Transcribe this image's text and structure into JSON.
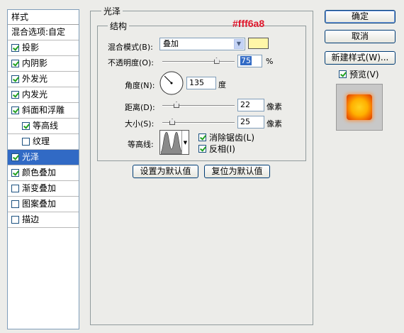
{
  "sidebar": {
    "header": "样式",
    "items": [
      {
        "label": "混合选项:自定",
        "checkbox": false,
        "checked": false,
        "sub": false,
        "selected": false
      },
      {
        "label": "投影",
        "checkbox": true,
        "checked": true,
        "sub": false,
        "selected": false
      },
      {
        "label": "内阴影",
        "checkbox": true,
        "checked": true,
        "sub": false,
        "selected": false
      },
      {
        "label": "外发光",
        "checkbox": true,
        "checked": true,
        "sub": false,
        "selected": false
      },
      {
        "label": "内发光",
        "checkbox": true,
        "checked": true,
        "sub": false,
        "selected": false
      },
      {
        "label": "斜面和浮雕",
        "checkbox": true,
        "checked": true,
        "sub": false,
        "selected": false
      },
      {
        "label": "等高线",
        "checkbox": true,
        "checked": true,
        "sub": true,
        "selected": false
      },
      {
        "label": "纹理",
        "checkbox": true,
        "checked": false,
        "sub": true,
        "selected": false
      },
      {
        "label": "光泽",
        "checkbox": true,
        "checked": true,
        "sub": false,
        "selected": true
      },
      {
        "label": "颜色叠加",
        "checkbox": true,
        "checked": true,
        "sub": false,
        "selected": false
      },
      {
        "label": "渐变叠加",
        "checkbox": true,
        "checked": false,
        "sub": false,
        "selected": false
      },
      {
        "label": "图案叠加",
        "checkbox": true,
        "checked": false,
        "sub": false,
        "selected": false
      },
      {
        "label": "描边",
        "checkbox": true,
        "checked": false,
        "sub": false,
        "selected": false
      }
    ]
  },
  "main": {
    "title": "光泽",
    "structure_title": "结构",
    "annotation": "#fff6a8",
    "annotation_color": "#e0162b",
    "blend_mode_label": "混合模式(B):",
    "blend_mode_value": "叠加",
    "blend_color": "#fff6a8",
    "opacity_label": "不透明度(O):",
    "opacity_value": "75",
    "opacity_unit": "%",
    "opacity_fraction": 0.75,
    "angle_label": "角度(N):",
    "angle_value": "135",
    "angle_unit": "度",
    "distance_label": "距离(D):",
    "distance_value": "22",
    "distance_unit": "像素",
    "size_label": "大小(S):",
    "size_value": "25",
    "size_unit": "像素",
    "contour_label": "等高线:",
    "antialias_label": "消除锯齿(L)",
    "antialias_checked": true,
    "invert_label": "反相(I)",
    "invert_checked": true,
    "set_default_button": "设置为默认值",
    "reset_default_button": "复位为默认值"
  },
  "right": {
    "ok_button": "确定",
    "cancel_button": "取消",
    "new_style_button": "新建样式(W)...",
    "preview_label": "预览(V)",
    "preview_checked": true
  }
}
